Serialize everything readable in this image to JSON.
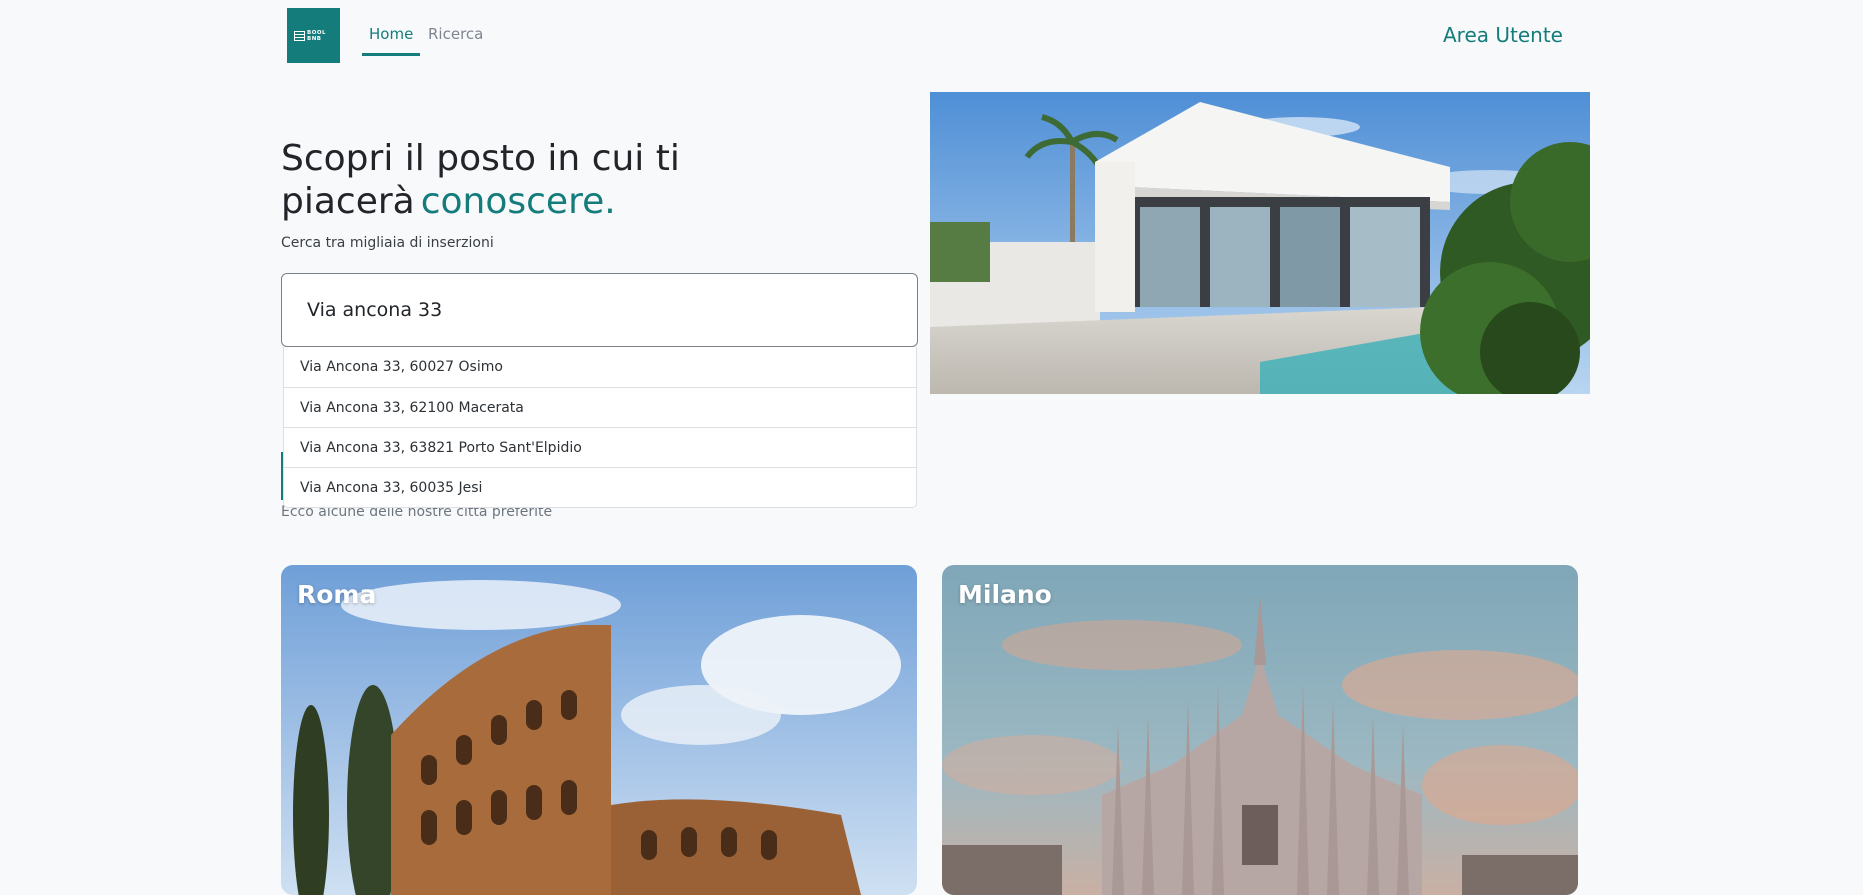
{
  "header": {
    "logo_text": "BOOL BNB",
    "nav": [
      {
        "label": "Home"
      },
      {
        "label": "Ricerca"
      }
    ],
    "area_utente": "Area Utente"
  },
  "hero": {
    "title_line1": "Scopri il posto in cui ti",
    "title_line2": "piacerà",
    "title_accent": "conoscere.",
    "subtitle": "Cerca tra migliaia di inserzioni"
  },
  "search": {
    "value": "Via ancona 33",
    "suggestions": [
      "Via Ancona 33, 60027 Osimo",
      "Via Ancona 33, 62100 Macerata",
      "Via Ancona 33, 63821 Porto Sant'Elpidio",
      "Via Ancona 33, 60035 Jesi"
    ]
  },
  "cities": {
    "subtitle": "Ecco alcune delle nostre città preferite",
    "items": [
      {
        "name": "Roma"
      },
      {
        "name": "Milano"
      }
    ]
  },
  "colors": {
    "accent": "#157c7c",
    "background": "#f8f9fb"
  }
}
